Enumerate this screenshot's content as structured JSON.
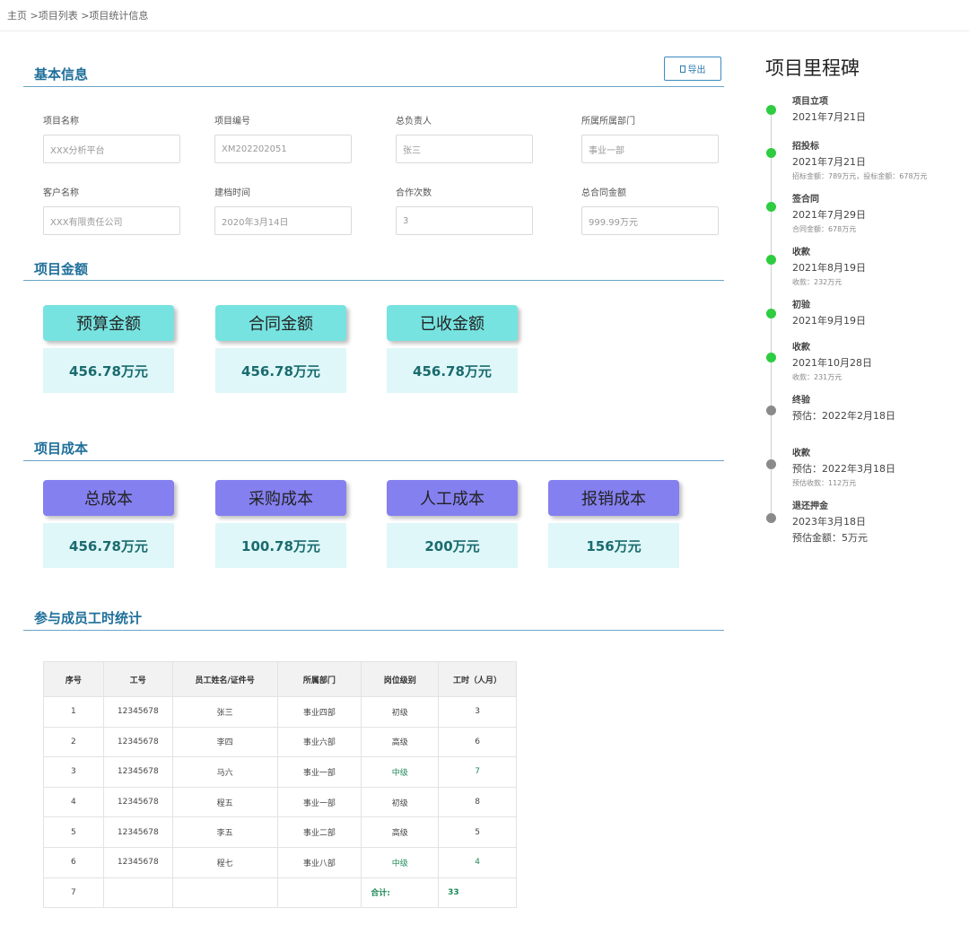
{
  "breadcrumb": {
    "home": "主页",
    "list": ">项目列表",
    "current": ">项目统计信息"
  },
  "export_button": {
    "label": "导出"
  },
  "basic_info": {
    "title": "基本信息",
    "fields": [
      {
        "label": "项目名称",
        "value": "XXX分析平台"
      },
      {
        "label": "项目编号",
        "value": "XM202202051"
      },
      {
        "label": "总负责人",
        "value": "张三"
      },
      {
        "label": "所属所属部门",
        "value": "事业一部"
      },
      {
        "label": "客户名称",
        "value": "XXX有限责任公司"
      },
      {
        "label": "建档时间",
        "value": "2020年3月14日"
      },
      {
        "label": "合作次数",
        "value": "3"
      },
      {
        "label": "总合同金额",
        "value": "999.99万元"
      }
    ]
  },
  "amounts": {
    "title": "项目金额",
    "cards": [
      {
        "label": "预算金额",
        "value": "456.78万元"
      },
      {
        "label": "合同金额",
        "value": "456.78万元"
      },
      {
        "label": "已收金额",
        "value": "456.78万元"
      }
    ]
  },
  "costs": {
    "title": "项目成本",
    "cards": [
      {
        "label": "总成本",
        "value": "456.78万元"
      },
      {
        "label": "采购成本",
        "value": "100.78万元"
      },
      {
        "label": "人工成本",
        "value": "200万元"
      },
      {
        "label": "报销成本",
        "value": "156万元"
      }
    ]
  },
  "staff": {
    "title": "参与成员工时统计",
    "columns": [
      "序号",
      "工号",
      "员工姓名/证件号",
      "所属部门",
      "岗位级别",
      "工时（人月）"
    ],
    "rows": [
      [
        "1",
        "12345678",
        "张三",
        "事业四部",
        "初级",
        "3"
      ],
      [
        "2",
        "12345678",
        "李四",
        "事业六部",
        "高级",
        "6"
      ],
      [
        "3",
        "12345678",
        "马六",
        "事业一部",
        "中级",
        "7"
      ],
      [
        "4",
        "12345678",
        "程五",
        "事业一部",
        "初级",
        "8"
      ],
      [
        "5",
        "12345678",
        "李五",
        "事业二部",
        "高级",
        "5"
      ],
      [
        "6",
        "12345678",
        "程七",
        "事业八部",
        "中级",
        "4"
      ]
    ],
    "total_row": {
      "index": "7",
      "label": "合计:",
      "value": "33"
    }
  },
  "milestones": {
    "title": "项目里程碑",
    "colors": {
      "done": "#2ecc40",
      "todo": "#8a8a8a"
    },
    "items": [
      {
        "name": "项目立项",
        "date": "2021年7月21日",
        "note": "",
        "status": "done"
      },
      {
        "name": "招投标",
        "date": "2021年7月21日",
        "note": "招标金额：789万元，投标金额：678万元",
        "status": "done"
      },
      {
        "name": "签合同",
        "date": "2021年7月29日",
        "note": "合同金额：678万元",
        "status": "done"
      },
      {
        "name": "收款",
        "date": "2021年8月19日",
        "note": "收款：232万元",
        "status": "done"
      },
      {
        "name": "初验",
        "date": "2021年9月19日",
        "note": "",
        "status": "done"
      },
      {
        "name": "收款",
        "date": "2021年10月28日",
        "note": "收款：231万元",
        "status": "done"
      },
      {
        "name": "终验",
        "date": "预估：2022年2月18日",
        "note": "",
        "status": "todo"
      },
      {
        "name": "收款",
        "date": "预估：2022年3月18日",
        "note": "预估收款：112万元",
        "status": "todo"
      },
      {
        "name": "退还押金",
        "date": "2023年3月18日",
        "note": "预估金额：5万元",
        "status": "todo"
      }
    ]
  }
}
